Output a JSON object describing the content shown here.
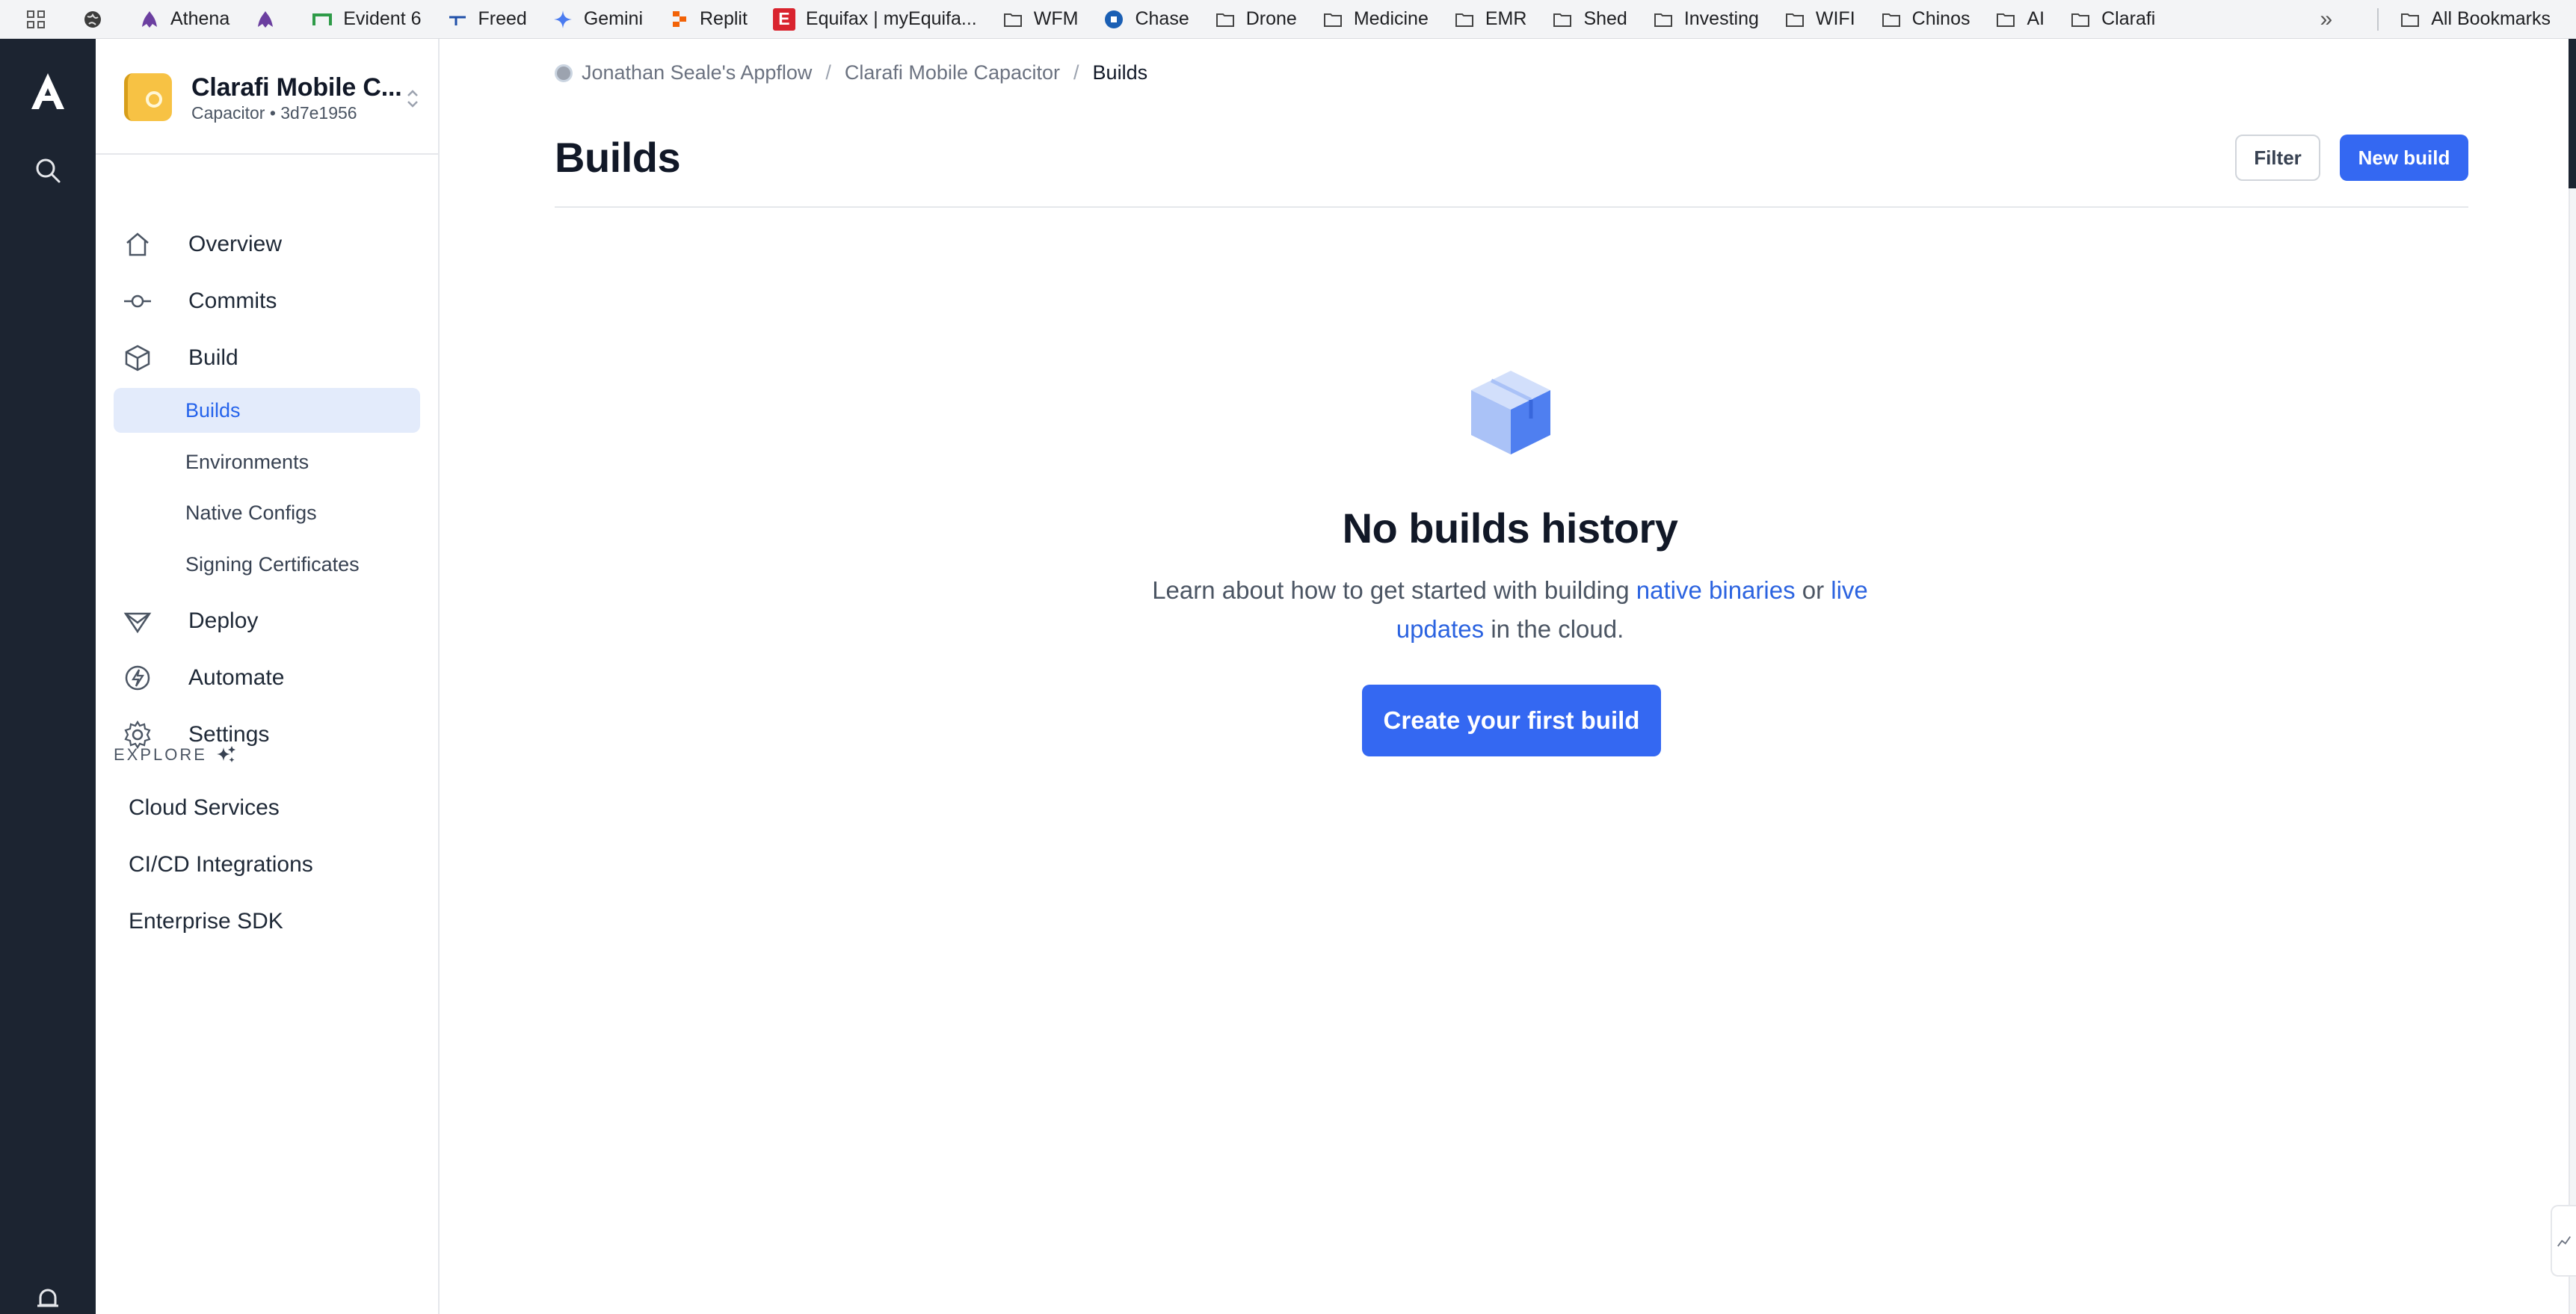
{
  "bookmarks": [
    {
      "label": "",
      "icon": "apps-grid-icon"
    },
    {
      "label": "",
      "icon": "globe-icon"
    },
    {
      "label": "Athena",
      "icon": "athena-icon"
    },
    {
      "label": "",
      "icon": "athena-icon"
    },
    {
      "label": "Evident 6",
      "icon": "evident-icon"
    },
    {
      "label": "Freed",
      "icon": "freed-icon"
    },
    {
      "label": "Gemini",
      "icon": "gemini-icon"
    },
    {
      "label": "Replit",
      "icon": "replit-icon"
    },
    {
      "label": "Equifax | myEquifa...",
      "icon": "equifax-icon"
    },
    {
      "label": "WFM",
      "icon": "folder-icon"
    },
    {
      "label": "Chase",
      "icon": "chase-icon"
    },
    {
      "label": "Drone",
      "icon": "folder-icon"
    },
    {
      "label": "Medicine",
      "icon": "folder-icon"
    },
    {
      "label": "EMR",
      "icon": "folder-icon"
    },
    {
      "label": "Shed",
      "icon": "folder-icon"
    },
    {
      "label": "Investing",
      "icon": "folder-icon"
    },
    {
      "label": "WIFI",
      "icon": "folder-icon"
    },
    {
      "label": "Chinos",
      "icon": "folder-icon"
    },
    {
      "label": "AI",
      "icon": "folder-icon"
    },
    {
      "label": "Clarafi",
      "icon": "folder-icon"
    }
  ],
  "bookmarks_overflow": "»",
  "all_bookmarks": "All Bookmarks",
  "project": {
    "name": "Clarafi Mobile C...",
    "subtitle": "Capacitor • 3d7e1956"
  },
  "nav": {
    "overview": "Overview",
    "commits": "Commits",
    "build": "Build",
    "builds": "Builds",
    "environments": "Environments",
    "native_configs": "Native Configs",
    "signing_certificates": "Signing Certificates",
    "deploy": "Deploy",
    "automate": "Automate",
    "settings": "Settings"
  },
  "explore": {
    "heading": "EXPLORE",
    "items": [
      "Cloud Services",
      "CI/CD Integrations",
      "Enterprise SDK"
    ]
  },
  "breadcrumb": {
    "org": "Jonathan Seale's Appflow",
    "app": "Clarafi Mobile Capacitor",
    "current": "Builds",
    "separator": "/"
  },
  "page": {
    "title": "Builds",
    "filter_label": "Filter",
    "new_build_label": "New build"
  },
  "empty_state": {
    "title": "No builds history",
    "text_before": "Learn about how to get started with building ",
    "link_native": "native binaries",
    "text_middle": " or ",
    "link_live": "live updates",
    "text_after": " in the cloud.",
    "cta_label": "Create your first build"
  },
  "colors": {
    "primary": "#3468f2",
    "rail": "#1c2431",
    "active_bg": "#e3ebfb",
    "link": "#2b63e0"
  }
}
